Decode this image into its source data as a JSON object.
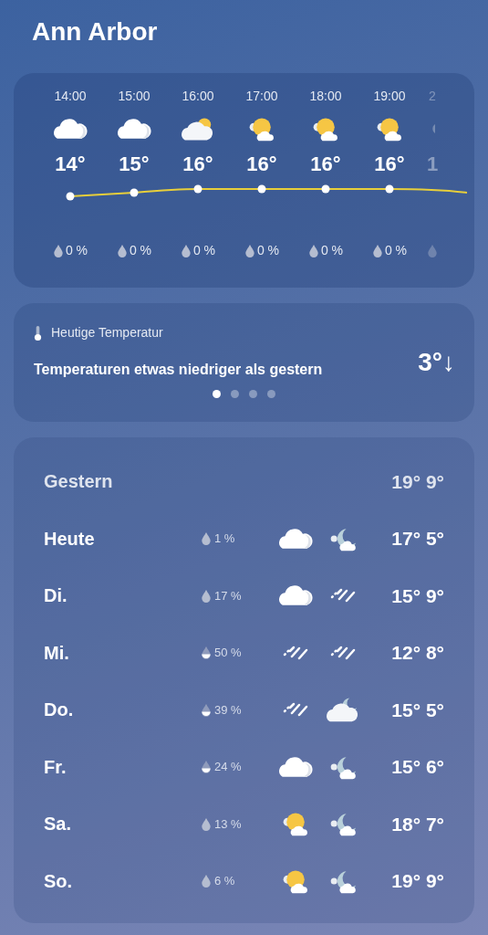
{
  "city": "Ann Arbor",
  "hourly": [
    {
      "time": "14:00",
      "kind": "cloud",
      "temp": "14°",
      "precip": "0 %",
      "half_filled": false,
      "faded": false
    },
    {
      "time": "15:00",
      "kind": "cloud",
      "temp": "15°",
      "precip": "0 %",
      "half_filled": false,
      "faded": false
    },
    {
      "time": "16:00",
      "kind": "cloud_sun",
      "temp": "16°",
      "precip": "0 %",
      "half_filled": false,
      "faded": false
    },
    {
      "time": "17:00",
      "kind": "sun_cloud",
      "temp": "16°",
      "precip": "0 %",
      "half_filled": false,
      "faded": false
    },
    {
      "time": "18:00",
      "kind": "sun_cloud",
      "temp": "16°",
      "precip": "0 %",
      "half_filled": false,
      "faded": false
    },
    {
      "time": "19:00",
      "kind": "sun_cloud",
      "temp": "16°",
      "precip": "0 %",
      "half_filled": false,
      "faded": false
    },
    {
      "time": "2",
      "kind": "partial",
      "temp": "1",
      "faded": true
    }
  ],
  "insight": {
    "label": "Heutige Temperatur",
    "text": "Temperaturen etwas niedriger als gestern",
    "delta": "3°↓",
    "pages": [
      {
        "selected": true
      },
      {
        "selected": false
      },
      {
        "selected": false
      },
      {
        "selected": false
      }
    ]
  },
  "daily": [
    {
      "day": "Gestern",
      "high": "19°",
      "low": "9°",
      "kind": "past"
    },
    {
      "day": "Heute",
      "precip": "1 %",
      "half_filled": false,
      "icons": [
        {
          "kind": "cloud"
        },
        {
          "kind": "moon_cloud"
        }
      ],
      "high": "17°",
      "low": "5°",
      "kind": "today"
    },
    {
      "day": "Di.",
      "precip": "17 %",
      "half_filled": false,
      "icons": [
        {
          "kind": "cloud"
        },
        {
          "kind": "rain"
        }
      ],
      "high": "15°",
      "low": "9°",
      "kind": "future"
    },
    {
      "day": "Mi.",
      "precip": "50 %",
      "half_filled": true,
      "icons": [
        {
          "kind": "rain"
        },
        {
          "kind": "rain"
        }
      ],
      "high": "12°",
      "low": "8°",
      "kind": "future"
    },
    {
      "day": "Do.",
      "precip": "39 %",
      "half_filled": true,
      "icons": [
        {
          "kind": "rain"
        },
        {
          "kind": "cloud_moon"
        }
      ],
      "high": "15°",
      "low": "5°",
      "kind": "future"
    },
    {
      "day": "Fr.",
      "precip": "24 %",
      "half_filled": true,
      "icons": [
        {
          "kind": "cloud"
        },
        {
          "kind": "moon_cloud"
        }
      ],
      "high": "15°",
      "low": "6°",
      "kind": "future"
    },
    {
      "day": "Sa.",
      "precip": "13 %",
      "half_filled": false,
      "icons": [
        {
          "kind": "sun_cloud"
        },
        {
          "kind": "moon_cloud"
        }
      ],
      "high": "18°",
      "low": "7°",
      "kind": "future"
    },
    {
      "day": "So.",
      "precip": "6 %",
      "half_filled": false,
      "icons": [
        {
          "kind": "sun_cloud"
        },
        {
          "kind": "moon_cloud"
        }
      ],
      "high": "19°",
      "low": "9°",
      "kind": "future"
    }
  ]
}
